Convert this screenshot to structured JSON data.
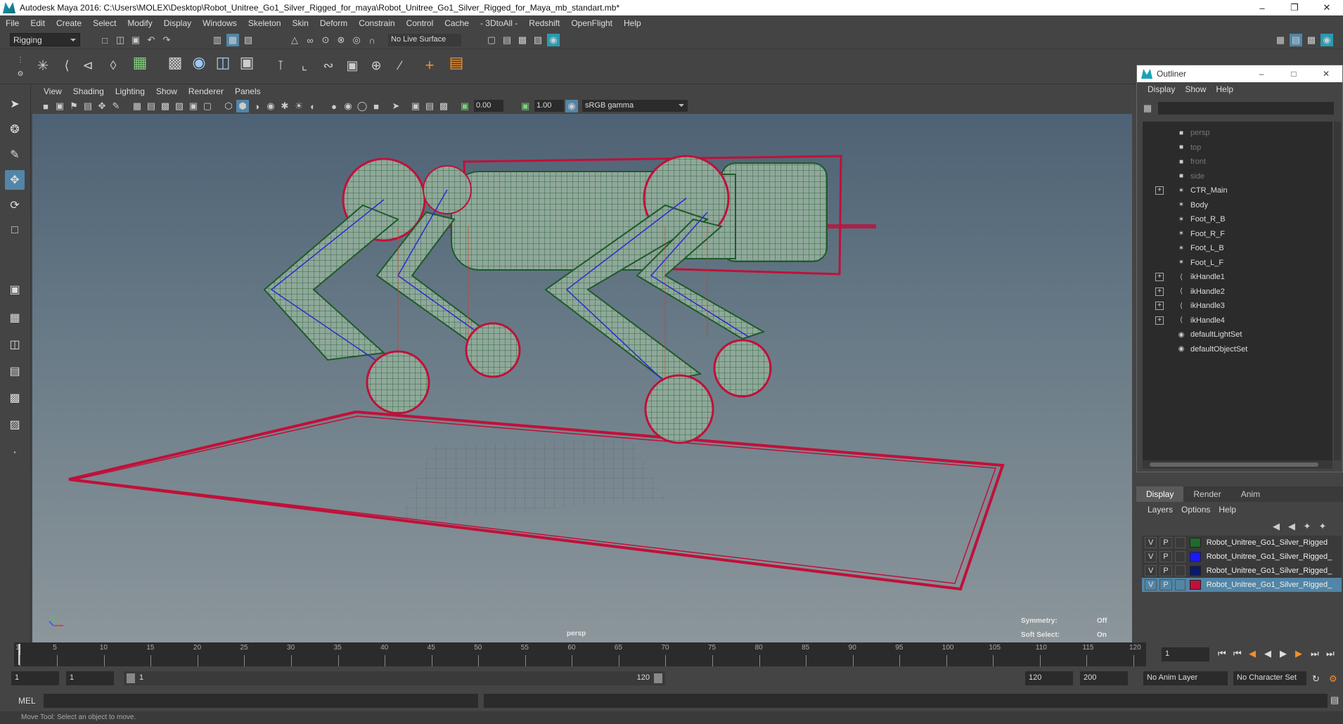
{
  "window": {
    "title": "Autodesk Maya 2016: C:\\Users\\MOLEX\\Desktop\\Robot_Unitree_Go1_Silver_Rigged_for_maya\\Robot_Unitree_Go1_Silver_Rigged_for_Maya_mb_standart.mb*",
    "minimize": "–",
    "restore": "❐",
    "close": "✕"
  },
  "menubar": [
    "File",
    "Edit",
    "Create",
    "Select",
    "Modify",
    "Display",
    "Windows",
    "Skeleton",
    "Skin",
    "Deform",
    "Constrain",
    "Control",
    "Cache",
    "- 3DtoAll -",
    "Redshift",
    "OpenFlight",
    "Help"
  ],
  "shelf": {
    "mode": "Rigging",
    "live_surface": "No Live Surface"
  },
  "viewport": {
    "menu": [
      "View",
      "Shading",
      "Lighting",
      "Show",
      "Renderer",
      "Panels"
    ],
    "exposure": "0.00",
    "gamma": "1.00",
    "color_space": "sRGB gamma",
    "camera": "persp",
    "symmetry_label": "Symmetry:",
    "symmetry_value": "Off",
    "soft_select_label": "Soft Select:",
    "soft_select_value": "On"
  },
  "outliner": {
    "title": "Outliner",
    "menu": [
      "Display",
      "Show",
      "Help"
    ],
    "items": [
      {
        "label": "persp",
        "dim": true,
        "icon": "camera-icon",
        "expandable": false
      },
      {
        "label": "top",
        "dim": true,
        "icon": "camera-icon",
        "expandable": false
      },
      {
        "label": "front",
        "dim": true,
        "icon": "camera-icon",
        "expandable": false
      },
      {
        "label": "side",
        "dim": true,
        "icon": "camera-icon",
        "expandable": false
      },
      {
        "label": "CTR_Main",
        "dim": false,
        "icon": "curve-icon",
        "expandable": true
      },
      {
        "label": "Body",
        "dim": false,
        "icon": "curve-icon",
        "expandable": false
      },
      {
        "label": "Foot_R_B",
        "dim": false,
        "icon": "curve-icon",
        "expandable": false
      },
      {
        "label": "Foot_R_F",
        "dim": false,
        "icon": "curve-icon",
        "expandable": false
      },
      {
        "label": "Foot_L_B",
        "dim": false,
        "icon": "curve-icon",
        "expandable": false
      },
      {
        "label": "Foot_L_F",
        "dim": false,
        "icon": "curve-icon",
        "expandable": false
      },
      {
        "label": "ikHandle1",
        "dim": false,
        "icon": "ik-handle-icon",
        "expandable": true
      },
      {
        "label": "ikHandle2",
        "dim": false,
        "icon": "ik-handle-icon",
        "expandable": true
      },
      {
        "label": "ikHandle3",
        "dim": false,
        "icon": "ik-handle-icon",
        "expandable": true
      },
      {
        "label": "ikHandle4",
        "dim": false,
        "icon": "ik-handle-icon",
        "expandable": true
      },
      {
        "label": "defaultLightSet",
        "dim": false,
        "icon": "set-icon",
        "expandable": false
      },
      {
        "label": "defaultObjectSet",
        "dim": false,
        "icon": "set-icon",
        "expandable": false
      }
    ]
  },
  "layers": {
    "tabs": [
      "Display",
      "Render",
      "Anim"
    ],
    "menu": [
      "Layers",
      "Options",
      "Help"
    ],
    "rows": [
      {
        "v": "V",
        "p": "P",
        "color": "#1e6b2a",
        "name": "Robot_Unitree_Go1_Silver_Rigged",
        "selected": false
      },
      {
        "v": "V",
        "p": "P",
        "color": "#1a1aff",
        "name": "Robot_Unitree_Go1_Silver_Rigged_",
        "selected": false
      },
      {
        "v": "V",
        "p": "P",
        "color": "#0a1a6b",
        "name": "Robot_Unitree_Go1_Silver_Rigged_",
        "selected": false
      },
      {
        "v": "V",
        "p": "P",
        "color": "#c0103a",
        "name": "Robot_Unitree_Go1_Silver_Rigged_",
        "selected": true
      }
    ]
  },
  "timeline": {
    "ticks": [
      "1",
      "5",
      "10",
      "15",
      "20",
      "25",
      "30",
      "35",
      "40",
      "45",
      "50",
      "55",
      "60",
      "65",
      "70",
      "75",
      "80",
      "85",
      "90",
      "95",
      "100",
      "105",
      "110",
      "115",
      "120"
    ],
    "current_frame": "1"
  },
  "range": {
    "start": "1",
    "playback_start": "1",
    "slider_start": "1",
    "slider_end": "120",
    "playback_end": "120",
    "end": "200",
    "anim_layer": "No Anim Layer",
    "character_set": "No Character Set"
  },
  "command": {
    "mel_label": "MEL"
  },
  "help_line": "Move Tool: Select an object to move.",
  "colors": {
    "accent": "#5285a6",
    "wire_green": "#1e6b2a",
    "ctrl_red": "#c0103a"
  }
}
